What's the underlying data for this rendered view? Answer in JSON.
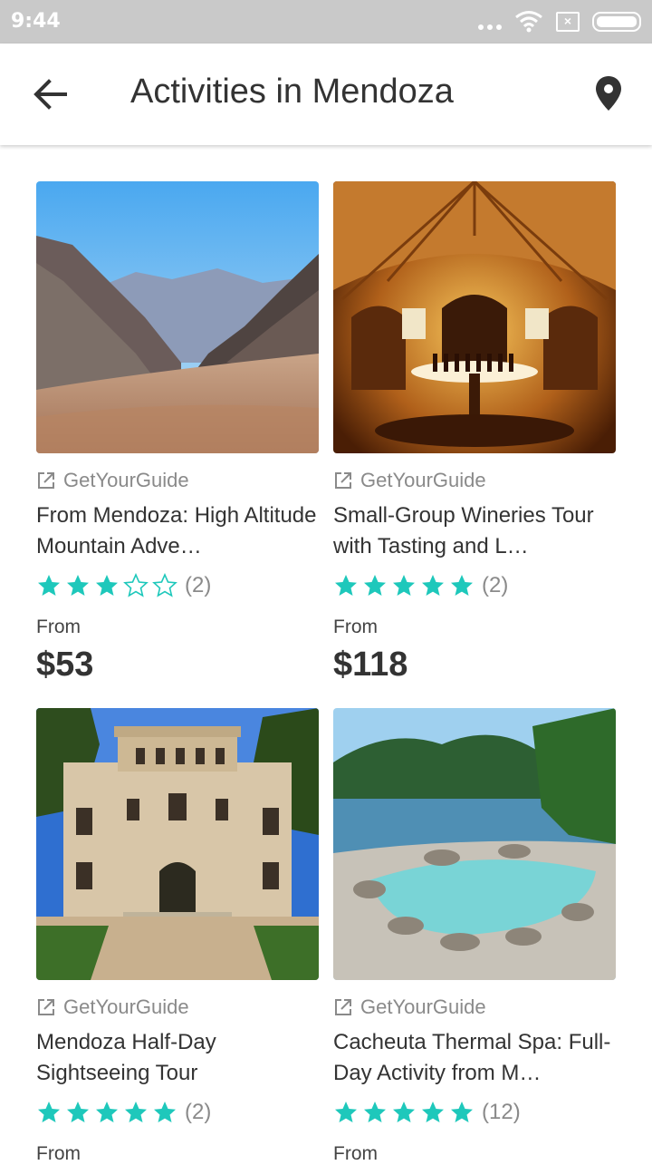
{
  "status_bar": {
    "time": "9:44",
    "sim_icon_glyph": "×"
  },
  "app_bar": {
    "title": "Activities in Mendoza",
    "back_icon": "arrow-left",
    "location_icon": "map-pin"
  },
  "colors": {
    "star": "#1ec8bb",
    "star_outline": "#1ec8bb",
    "muted": "#8a8a8a"
  },
  "activities": [
    {
      "provider": "GetYourGuide",
      "name": "From Mendoza: High Altitude Mountain Adve…",
      "rating": 3,
      "reviews": "(2)",
      "from_label": "From",
      "price": "$53",
      "image": "mountain-valley"
    },
    {
      "provider": "GetYourGuide",
      "name": "Small-Group Wineries Tour with Tasting and L…",
      "rating": 5,
      "reviews": "(2)",
      "from_label": "From",
      "price": "$118",
      "image": "wine-cellar"
    },
    {
      "provider": "GetYourGuide",
      "name": "Mendoza Half-Day Sightseeing Tour",
      "rating": 5,
      "reviews": "(2)",
      "from_label": "From",
      "price": "",
      "image": "historic-building"
    },
    {
      "provider": "GetYourGuide",
      "name": "Cacheuta Thermal Spa: Full-Day Activity from M…",
      "rating": 5,
      "reviews": "(12)",
      "from_label": "From",
      "price": "",
      "image": "thermal-pool"
    }
  ]
}
